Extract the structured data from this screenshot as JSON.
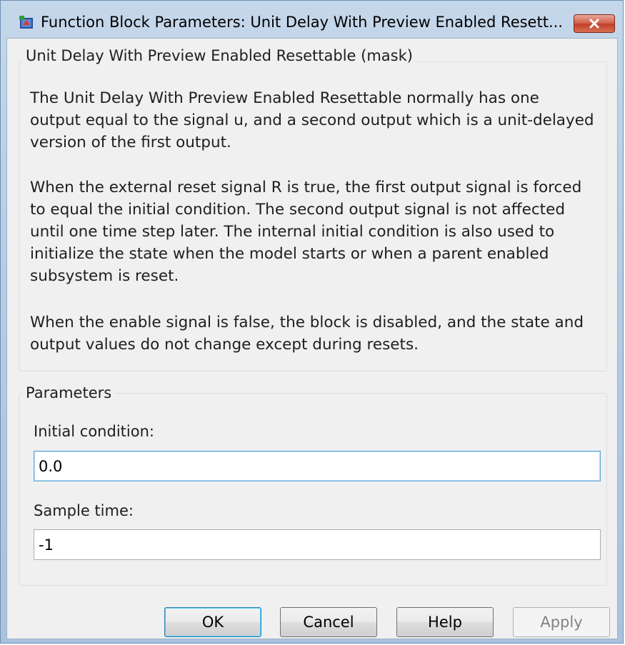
{
  "window": {
    "title": "Function Block Parameters: Unit Delay With Preview Enabled Resett...",
    "close_icon": "close-icon"
  },
  "mask": {
    "legend": "Unit Delay With Preview Enabled Resettable (mask)",
    "paragraphs": [
      "The Unit Delay With Preview Enabled Resettable normally has one output equal to the signal u, and a second output which is a unit-delayed version of the first output.",
      "When the external reset signal R is true, the first output signal is forced to equal the initial condition. The second output signal is not affected until one time step later. The internal initial condition is also used to initialize the state when the model starts or when a parent enabled subsystem is reset.",
      "When the enable signal is false, the block is disabled, and the state and output values do not change except during resets."
    ]
  },
  "parameters": {
    "legend": "Parameters",
    "initial_condition_label": "Initial condition:",
    "initial_condition_value": "0.0",
    "sample_time_label": "Sample time:",
    "sample_time_value": "-1"
  },
  "buttons": {
    "ok": "OK",
    "cancel": "Cancel",
    "help": "Help",
    "apply": "Apply"
  },
  "colors": {
    "frame": "#b7cde4",
    "client": "#f0f0f0",
    "close_button": "#c1412b",
    "focus_border": "#5fa8d8"
  }
}
